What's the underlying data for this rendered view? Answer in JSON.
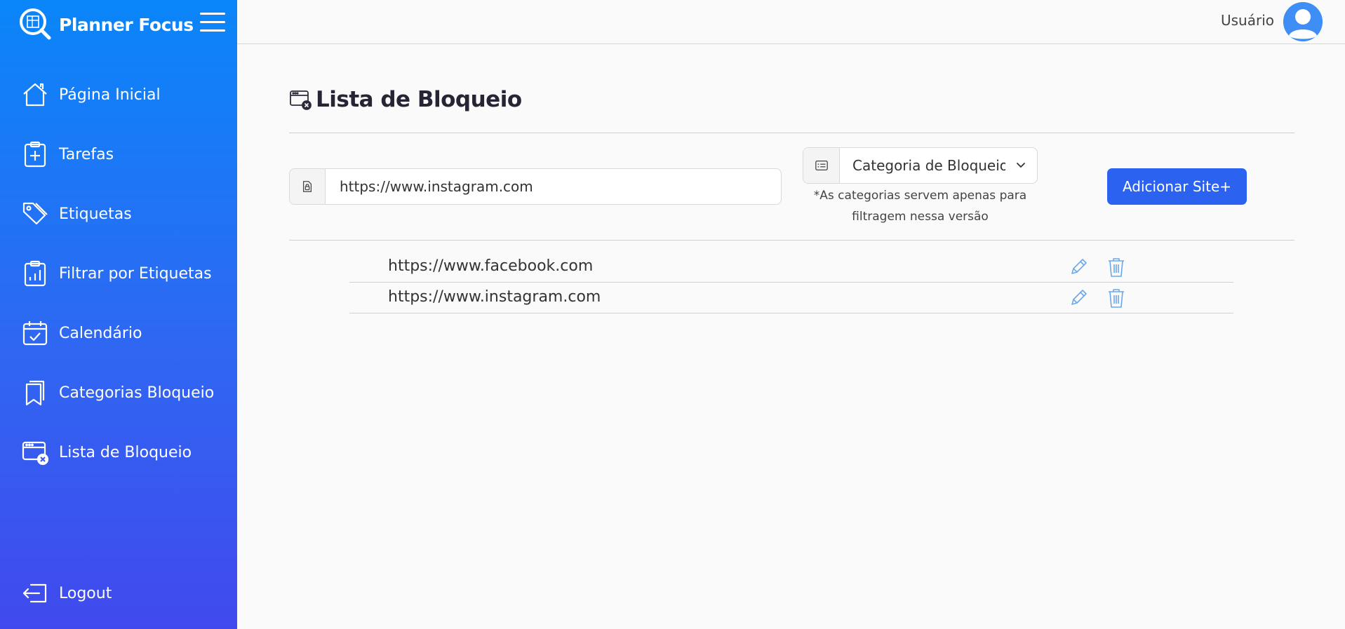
{
  "app": {
    "name": "Planner Focus"
  },
  "sidebar": {
    "items": [
      {
        "label": "Página Inicial",
        "icon": "home-icon"
      },
      {
        "label": "Tarefas",
        "icon": "clipboard-plus-icon"
      },
      {
        "label": "Etiquetas",
        "icon": "tags-icon"
      },
      {
        "label": "Filtrar por Etiquetas",
        "icon": "clipboard-chart-icon"
      },
      {
        "label": "Calendário",
        "icon": "calendar-check-icon"
      },
      {
        "label": "Categorias Bloqueio",
        "icon": "bookmarks-icon"
      },
      {
        "label": "Lista de Bloqueio",
        "icon": "blocked-window-icon"
      }
    ],
    "logout_label": "Logout"
  },
  "topbar": {
    "user_label": "Usuário"
  },
  "page": {
    "title": "Lista de Bloqueio",
    "url_input_value": "https://www.instagram.com",
    "category_select_value": "Categoria de Bloqueio",
    "category_note": "*As categorias servem apenas para filtragem nessa versão",
    "add_button_label": "Adicionar Site+"
  },
  "blocked_sites": [
    "https://www.facebook.com",
    "https://www.instagram.com"
  ],
  "colors": {
    "sidebar_top": "#0a86f9",
    "sidebar_bottom": "#4149ee",
    "primary_button": "#2c62f0",
    "action_icon": "#6aa8ea"
  }
}
